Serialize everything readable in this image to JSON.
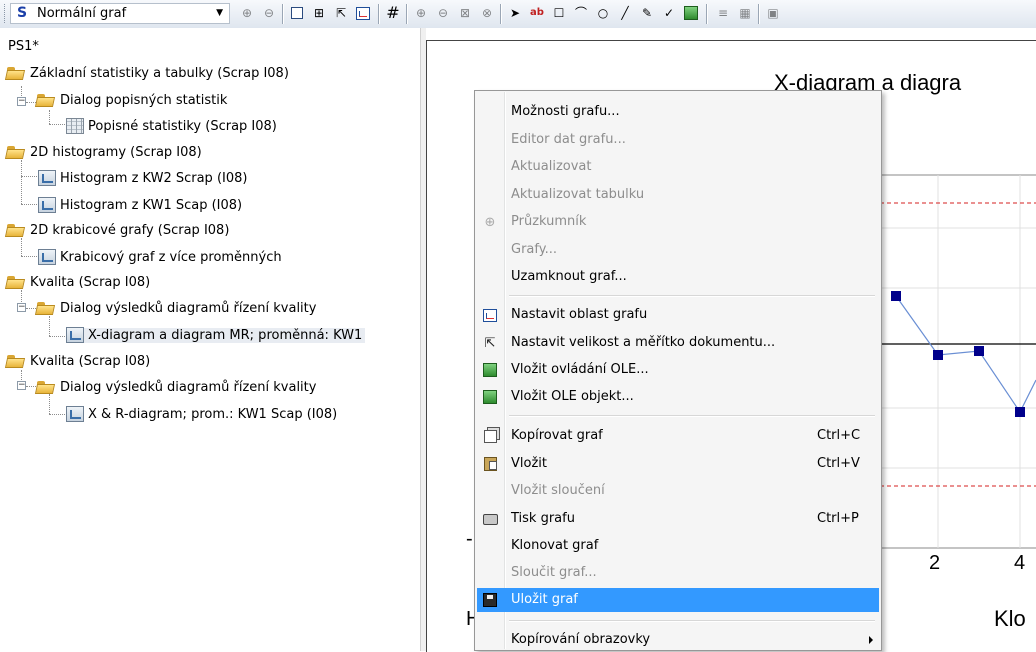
{
  "toolbar": {
    "graph_type_icon": "S",
    "graph_type": "Normální graf",
    "icons": [
      "zoom-in-icon",
      "zoom-out-icon",
      "select-box-icon",
      "graph-edit-icon",
      "resize-icon",
      "plot-area-icon",
      "grid-icon",
      "zoom-icon",
      "zoom-out-icon-2",
      "zoom-reset-icon",
      "zoom-cancel-icon",
      "pointer-icon",
      "text-icon",
      "annotation-icon",
      "freeform-icon",
      "ellipse-icon",
      "line-icon",
      "brush-icon",
      "marker-icon",
      "ole-icon",
      "disabled-icon",
      "tile-icon",
      "extra-icon"
    ]
  },
  "tree": {
    "title": "PS1*",
    "nodes": [
      {
        "label": "Základní statistiky a tabulky (Scrap I08)",
        "icon": "folder-icon",
        "level": 0
      },
      {
        "label": "Dialog popisných statistik",
        "icon": "folder-icon",
        "level": 1
      },
      {
        "label": "Popisné statistiky (Scrap I08)",
        "icon": "table-icon",
        "level": 2
      },
      {
        "label": "2D histogramy (Scrap I08)",
        "icon": "folder-icon",
        "level": 0
      },
      {
        "label": "Histogram z KW2 Scrap (I08)",
        "icon": "graph-icon",
        "level": 1
      },
      {
        "label": "Histogram z KW1 Scap (I08)",
        "icon": "graph-icon",
        "level": 1
      },
      {
        "label": "2D krabicové grafy (Scrap I08)",
        "icon": "folder-icon",
        "level": 0
      },
      {
        "label": "Krabicový graf z více proměnných",
        "icon": "graph-icon",
        "level": 1
      },
      {
        "label": "Kvalita (Scrap I08)",
        "icon": "folder-icon",
        "level": 0
      },
      {
        "label": "Dialog výsledků diagramů řízení kvality",
        "icon": "folder-icon",
        "level": 1
      },
      {
        "label": "X-diagram a diagram MR; proměnná: KW1",
        "icon": "graph-icon",
        "level": 2
      },
      {
        "label": "Kvalita (Scrap I08)",
        "icon": "folder-icon",
        "level": 0
      },
      {
        "label": "Dialog výsledků diagramů řízení kvality",
        "icon": "folder-icon",
        "level": 1
      },
      {
        "label": "X & R-diagram; prom.: KW1 Scap (I08)",
        "icon": "graph-icon",
        "level": 2
      }
    ]
  },
  "chart": {
    "title": "X-diagram a diagra",
    "x_ticks": [
      "2",
      "4"
    ],
    "xlabel_fragment": "Klo",
    "left_fragments": [
      "-",
      "H"
    ],
    "marker_color": "#00008b",
    "line_color": "#6a8fd4",
    "limit_color": "#d62020"
  },
  "context_menu": {
    "items": [
      {
        "type": "item",
        "label": "Možnosti grafu...",
        "disabled": false,
        "icon": ""
      },
      {
        "type": "item",
        "label": "Editor dat grafu...",
        "disabled": true,
        "icon": ""
      },
      {
        "type": "item",
        "label": "Aktualizovat",
        "disabled": true,
        "icon": ""
      },
      {
        "type": "item",
        "label": "Aktualizovat tabulku",
        "disabled": true,
        "icon": ""
      },
      {
        "type": "item",
        "label": "Průzkumník",
        "disabled": true,
        "icon": "explorer-icon"
      },
      {
        "type": "item",
        "label": "Grafy...",
        "disabled": true,
        "icon": ""
      },
      {
        "type": "item",
        "label": "Uzamknout graf...",
        "disabled": false,
        "icon": ""
      },
      {
        "type": "separator"
      },
      {
        "type": "item",
        "label": "Nastavit oblast grafu",
        "disabled": false,
        "icon": "plot-area-icon"
      },
      {
        "type": "item",
        "label": "Nastavit velikost a  měřítko dokumentu...",
        "disabled": false,
        "icon": "resize-icon"
      },
      {
        "type": "item",
        "label": "Vložit ovládání OLE...",
        "disabled": false,
        "icon": "ole-control-icon"
      },
      {
        "type": "item",
        "label": "Vložit OLE objekt...",
        "disabled": false,
        "icon": "ole-object-icon"
      },
      {
        "type": "separator"
      },
      {
        "type": "item",
        "label": "Kopírovat graf",
        "shortcut": "Ctrl+C",
        "disabled": false,
        "icon": "copy-icon"
      },
      {
        "type": "item",
        "label": "Vložit",
        "shortcut": "Ctrl+V",
        "disabled": false,
        "icon": "paste-icon"
      },
      {
        "type": "item",
        "label": "Vložit sloučení",
        "disabled": true,
        "icon": ""
      },
      {
        "type": "item",
        "label": "Tisk grafu",
        "shortcut": "Ctrl+P",
        "disabled": false,
        "icon": "print-icon"
      },
      {
        "type": "item",
        "label": "Klonovat graf",
        "disabled": false,
        "icon": ""
      },
      {
        "type": "item",
        "label": "Sloučit graf...",
        "disabled": true,
        "icon": ""
      },
      {
        "type": "item",
        "label": "Uložit graf",
        "disabled": false,
        "highlighted": true,
        "icon": "save-icon"
      },
      {
        "type": "separator"
      },
      {
        "type": "item",
        "label": "Kopírování obrazovky",
        "disabled": false,
        "submenu": true,
        "icon": ""
      }
    ]
  }
}
